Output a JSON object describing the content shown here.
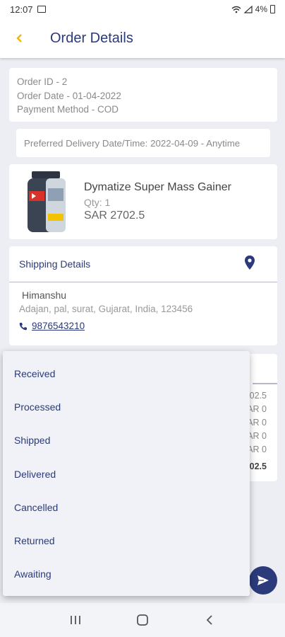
{
  "status_bar": {
    "time": "12:07",
    "battery": "4%"
  },
  "app_bar": {
    "title": "Order Details"
  },
  "order": {
    "id": "Order ID - 2",
    "date": "Order Date - 01-04-2022",
    "payment": "Payment Method - COD"
  },
  "preferred_delivery": "Preferred Delivery Date/Time: 2022-04-09 - Anytime",
  "product": {
    "name": "Dymatize Super Mass Gainer",
    "qty": "Qty: 1",
    "price": "SAR 2702.5"
  },
  "shipping": {
    "title": "Shipping Details",
    "name": "Himanshu",
    "address": "Adajan, pal, surat, Gujarat, India, 123456",
    "phone": "9876543210"
  },
  "summary_values": [
    "02.5",
    "AR 0",
    "AR 0",
    "AR 0",
    "AR 0",
    "02.5"
  ],
  "status_dropdown": {
    "options": [
      "Received",
      "Processed",
      "Shipped",
      "Delivered",
      "Cancelled",
      "Returned",
      "Awaiting"
    ]
  },
  "colors": {
    "primary": "#2b3a7a",
    "accent": "#f2b705"
  }
}
